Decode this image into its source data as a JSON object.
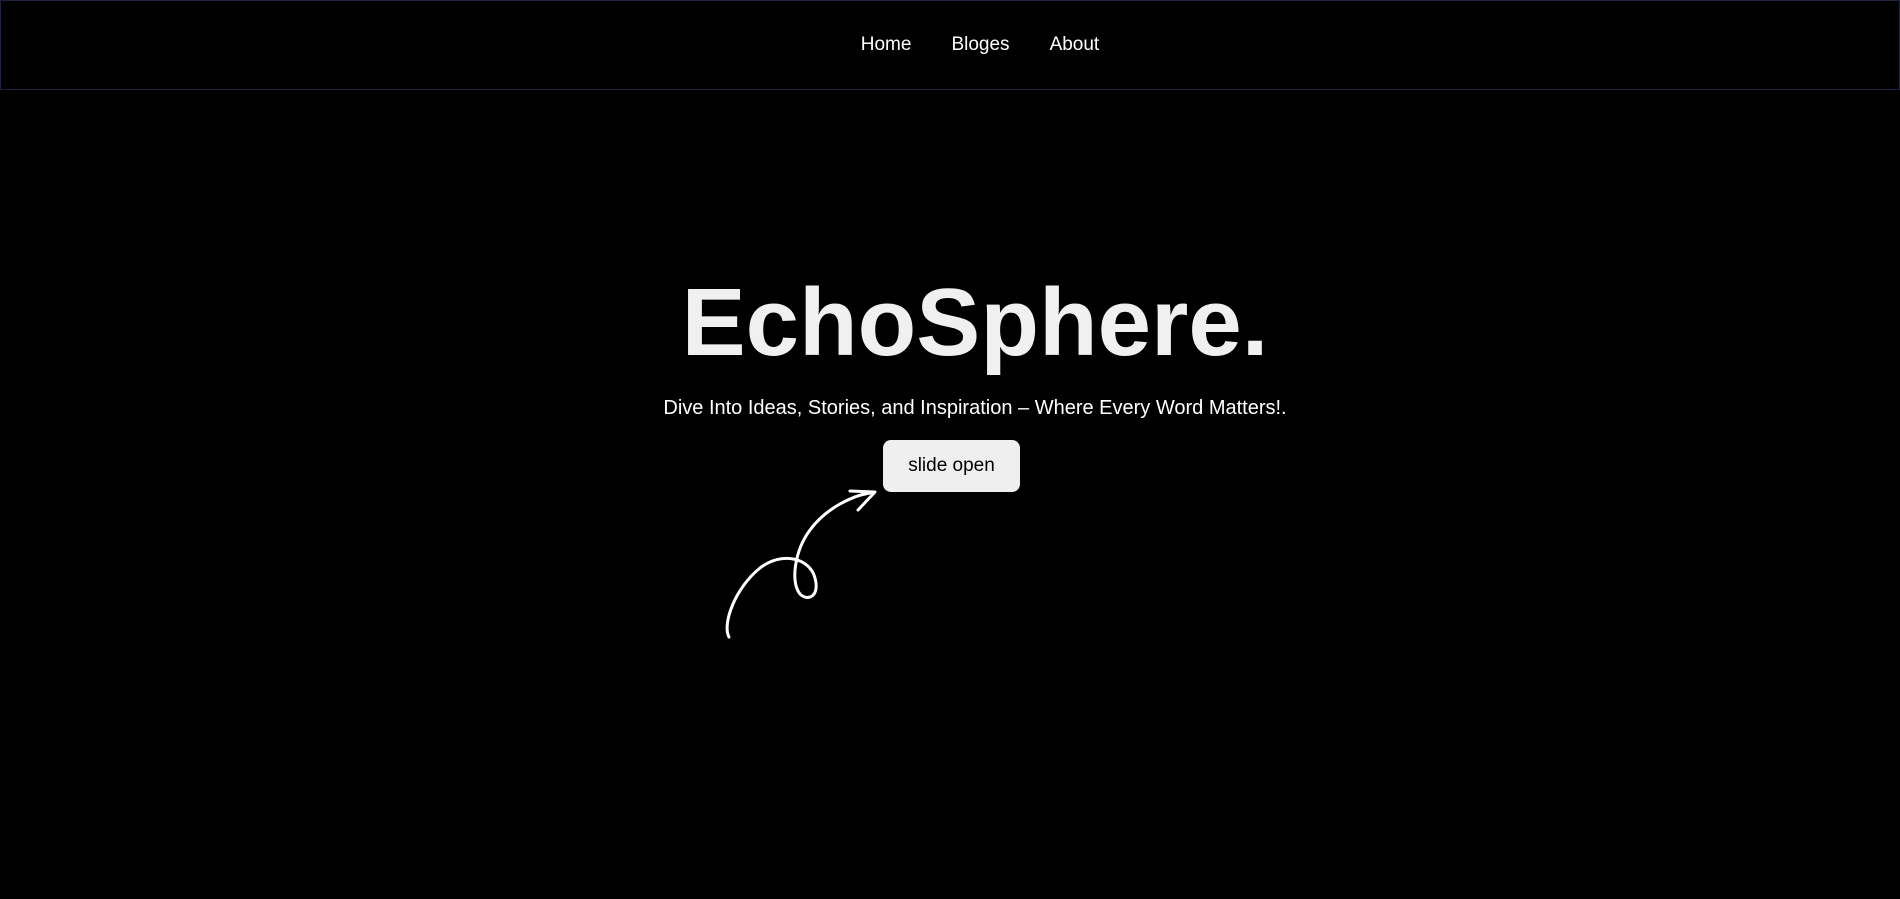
{
  "nav": {
    "links": [
      {
        "label": "Home"
      },
      {
        "label": "Bloges"
      },
      {
        "label": "About"
      }
    ]
  },
  "hero": {
    "title": "EchoSphere.",
    "tagline": "Dive Into Ideas, Stories, and Inspiration – Where Every Word Matters!.",
    "button_label": "slide open",
    "arrow_icon": "curly-arrow-icon"
  },
  "colors": {
    "background": "#000000",
    "title": "#f0f0f0",
    "button_bg": "#efefef",
    "nav_border": "#1c2240"
  }
}
